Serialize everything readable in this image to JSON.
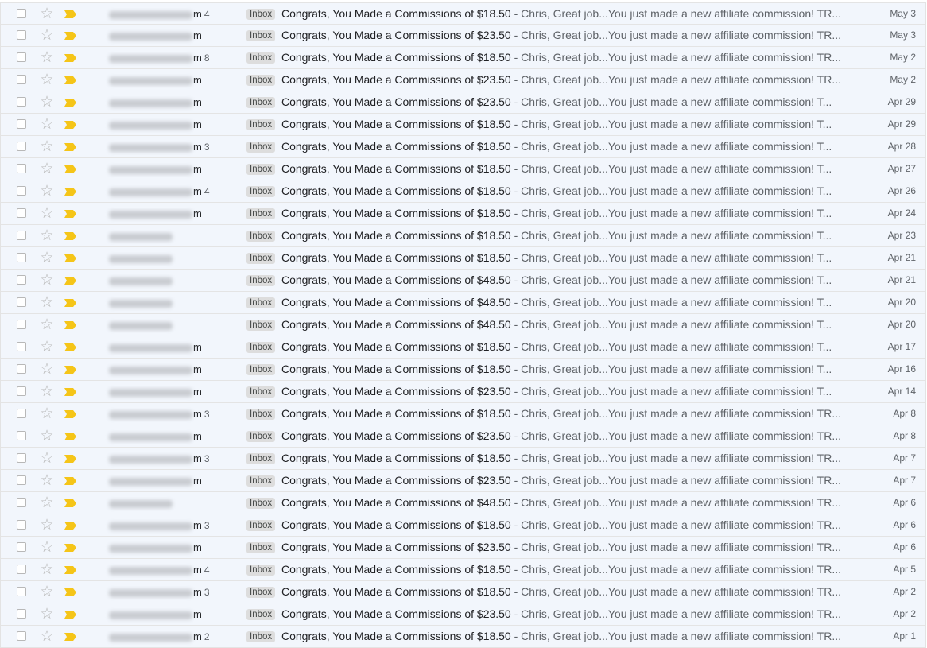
{
  "colors": {
    "important_marker": "#f5c518",
    "row_background": "#f2f6fc",
    "star": "#b8b8b8"
  },
  "emails": [
    {
      "sender_suffix": "m",
      "count": "4",
      "label": "Inbox",
      "subject": "Congrats, You Made a Commissions of $18.50",
      "snippet": " - Chris, Great job...You just made a new affiliate commission! TR...",
      "date": "May 3"
    },
    {
      "sender_suffix": "m",
      "count": "",
      "label": "Inbox",
      "subject": "Congrats, You Made a Commissions of $23.50",
      "snippet": " - Chris, Great job...You just made a new affiliate commission! TR...",
      "date": "May 3"
    },
    {
      "sender_suffix": "m",
      "count": "8",
      "label": "Inbox",
      "subject": "Congrats, You Made a Commissions of $18.50",
      "snippet": " - Chris, Great job...You just made a new affiliate commission! TR...",
      "date": "May 2"
    },
    {
      "sender_suffix": "m",
      "count": "",
      "label": "Inbox",
      "subject": "Congrats, You Made a Commissions of $23.50",
      "snippet": " - Chris, Great job...You just made a new affiliate commission! TR...",
      "date": "May 2"
    },
    {
      "sender_suffix": "m",
      "count": "",
      "label": "Inbox",
      "subject": "Congrats, You Made a Commissions of $23.50",
      "snippet": " - Chris, Great job...You just made a new affiliate commission! T...",
      "date": "Apr 29"
    },
    {
      "sender_suffix": "m",
      "count": "",
      "label": "Inbox",
      "subject": "Congrats, You Made a Commissions of $18.50",
      "snippet": " - Chris, Great job...You just made a new affiliate commission! T...",
      "date": "Apr 29"
    },
    {
      "sender_suffix": "m",
      "count": "3",
      "label": "Inbox",
      "subject": "Congrats, You Made a Commissions of $18.50",
      "snippet": " - Chris, Great job...You just made a new affiliate commission! T...",
      "date": "Apr 28"
    },
    {
      "sender_suffix": "m",
      "count": "",
      "label": "Inbox",
      "subject": "Congrats, You Made a Commissions of $18.50",
      "snippet": " - Chris, Great job...You just made a new affiliate commission! T...",
      "date": "Apr 27"
    },
    {
      "sender_suffix": "m",
      "count": "4",
      "label": "Inbox",
      "subject": "Congrats, You Made a Commissions of $18.50",
      "snippet": " - Chris, Great job...You just made a new affiliate commission! T...",
      "date": "Apr 26"
    },
    {
      "sender_suffix": "m",
      "count": "",
      "label": "Inbox",
      "subject": "Congrats, You Made a Commissions of $18.50",
      "snippet": " - Chris, Great job...You just made a new affiliate commission! T...",
      "date": "Apr 24"
    },
    {
      "sender_suffix": "",
      "count": "",
      "label": "Inbox",
      "subject": "Congrats, You Made a Commissions of $18.50",
      "snippet": " - Chris, Great job...You just made a new affiliate commission! T...",
      "date": "Apr 23"
    },
    {
      "sender_suffix": "",
      "count": "",
      "label": "Inbox",
      "subject": "Congrats, You Made a Commissions of $18.50",
      "snippet": " - Chris, Great job...You just made a new affiliate commission! T...",
      "date": "Apr 21"
    },
    {
      "sender_suffix": "",
      "count": "",
      "label": "Inbox",
      "subject": "Congrats, You Made a Commissions of $48.50",
      "snippet": " - Chris, Great job...You just made a new affiliate commission! T...",
      "date": "Apr 21"
    },
    {
      "sender_suffix": "",
      "count": "",
      "label": "Inbox",
      "subject": "Congrats, You Made a Commissions of $48.50",
      "snippet": " - Chris, Great job...You just made a new affiliate commission! T...",
      "date": "Apr 20"
    },
    {
      "sender_suffix": "",
      "count": "",
      "label": "Inbox",
      "subject": "Congrats, You Made a Commissions of $48.50",
      "snippet": " - Chris, Great job...You just made a new affiliate commission! T...",
      "date": "Apr 20"
    },
    {
      "sender_suffix": "m",
      "count": "",
      "label": "Inbox",
      "subject": "Congrats, You Made a Commissions of $18.50",
      "snippet": " - Chris, Great job...You just made a new affiliate commission! T...",
      "date": "Apr 17"
    },
    {
      "sender_suffix": "m",
      "count": "",
      "label": "Inbox",
      "subject": "Congrats, You Made a Commissions of $18.50",
      "snippet": " - Chris, Great job...You just made a new affiliate commission! T...",
      "date": "Apr 16"
    },
    {
      "sender_suffix": "m",
      "count": "",
      "label": "Inbox",
      "subject": "Congrats, You Made a Commissions of $23.50",
      "snippet": " - Chris, Great job...You just made a new affiliate commission! T...",
      "date": "Apr 14"
    },
    {
      "sender_suffix": "m",
      "count": "3",
      "label": "Inbox",
      "subject": "Congrats, You Made a Commissions of $18.50",
      "snippet": " - Chris, Great job...You just made a new affiliate commission! TR...",
      "date": "Apr 8"
    },
    {
      "sender_suffix": "m",
      "count": "",
      "label": "Inbox",
      "subject": "Congrats, You Made a Commissions of $23.50",
      "snippet": " - Chris, Great job...You just made a new affiliate commission! TR...",
      "date": "Apr 8"
    },
    {
      "sender_suffix": "m",
      "count": "3",
      "label": "Inbox",
      "subject": "Congrats, You Made a Commissions of $18.50",
      "snippet": " - Chris, Great job...You just made a new affiliate commission! TR...",
      "date": "Apr 7"
    },
    {
      "sender_suffix": "m",
      "count": "",
      "label": "Inbox",
      "subject": "Congrats, You Made a Commissions of $23.50",
      "snippet": " - Chris, Great job...You just made a new affiliate commission! TR...",
      "date": "Apr 7"
    },
    {
      "sender_suffix": "",
      "count": "",
      "label": "Inbox",
      "subject": "Congrats, You Made a Commissions of $48.50",
      "snippet": " - Chris, Great job...You just made a new affiliate commission! TR...",
      "date": "Apr 6"
    },
    {
      "sender_suffix": "m",
      "count": "3",
      "label": "Inbox",
      "subject": "Congrats, You Made a Commissions of $18.50",
      "snippet": " - Chris, Great job...You just made a new affiliate commission! TR...",
      "date": "Apr 6"
    },
    {
      "sender_suffix": "m",
      "count": "",
      "label": "Inbox",
      "subject": "Congrats, You Made a Commissions of $23.50",
      "snippet": " - Chris, Great job...You just made a new affiliate commission! TR...",
      "date": "Apr 6"
    },
    {
      "sender_suffix": "m",
      "count": "4",
      "label": "Inbox",
      "subject": "Congrats, You Made a Commissions of $18.50",
      "snippet": " - Chris, Great job...You just made a new affiliate commission! TR...",
      "date": "Apr 5"
    },
    {
      "sender_suffix": "m",
      "count": "3",
      "label": "Inbox",
      "subject": "Congrats, You Made a Commissions of $18.50",
      "snippet": " - Chris, Great job...You just made a new affiliate commission! TR...",
      "date": "Apr 2"
    },
    {
      "sender_suffix": "m",
      "count": "",
      "label": "Inbox",
      "subject": "Congrats, You Made a Commissions of $23.50",
      "snippet": " - Chris, Great job...You just made a new affiliate commission! TR...",
      "date": "Apr 2"
    },
    {
      "sender_suffix": "m",
      "count": "2",
      "label": "Inbox",
      "subject": "Congrats, You Made a Commissions of $18.50",
      "snippet": " - Chris, Great job...You just made a new affiliate commission! TR...",
      "date": "Apr 1"
    }
  ]
}
